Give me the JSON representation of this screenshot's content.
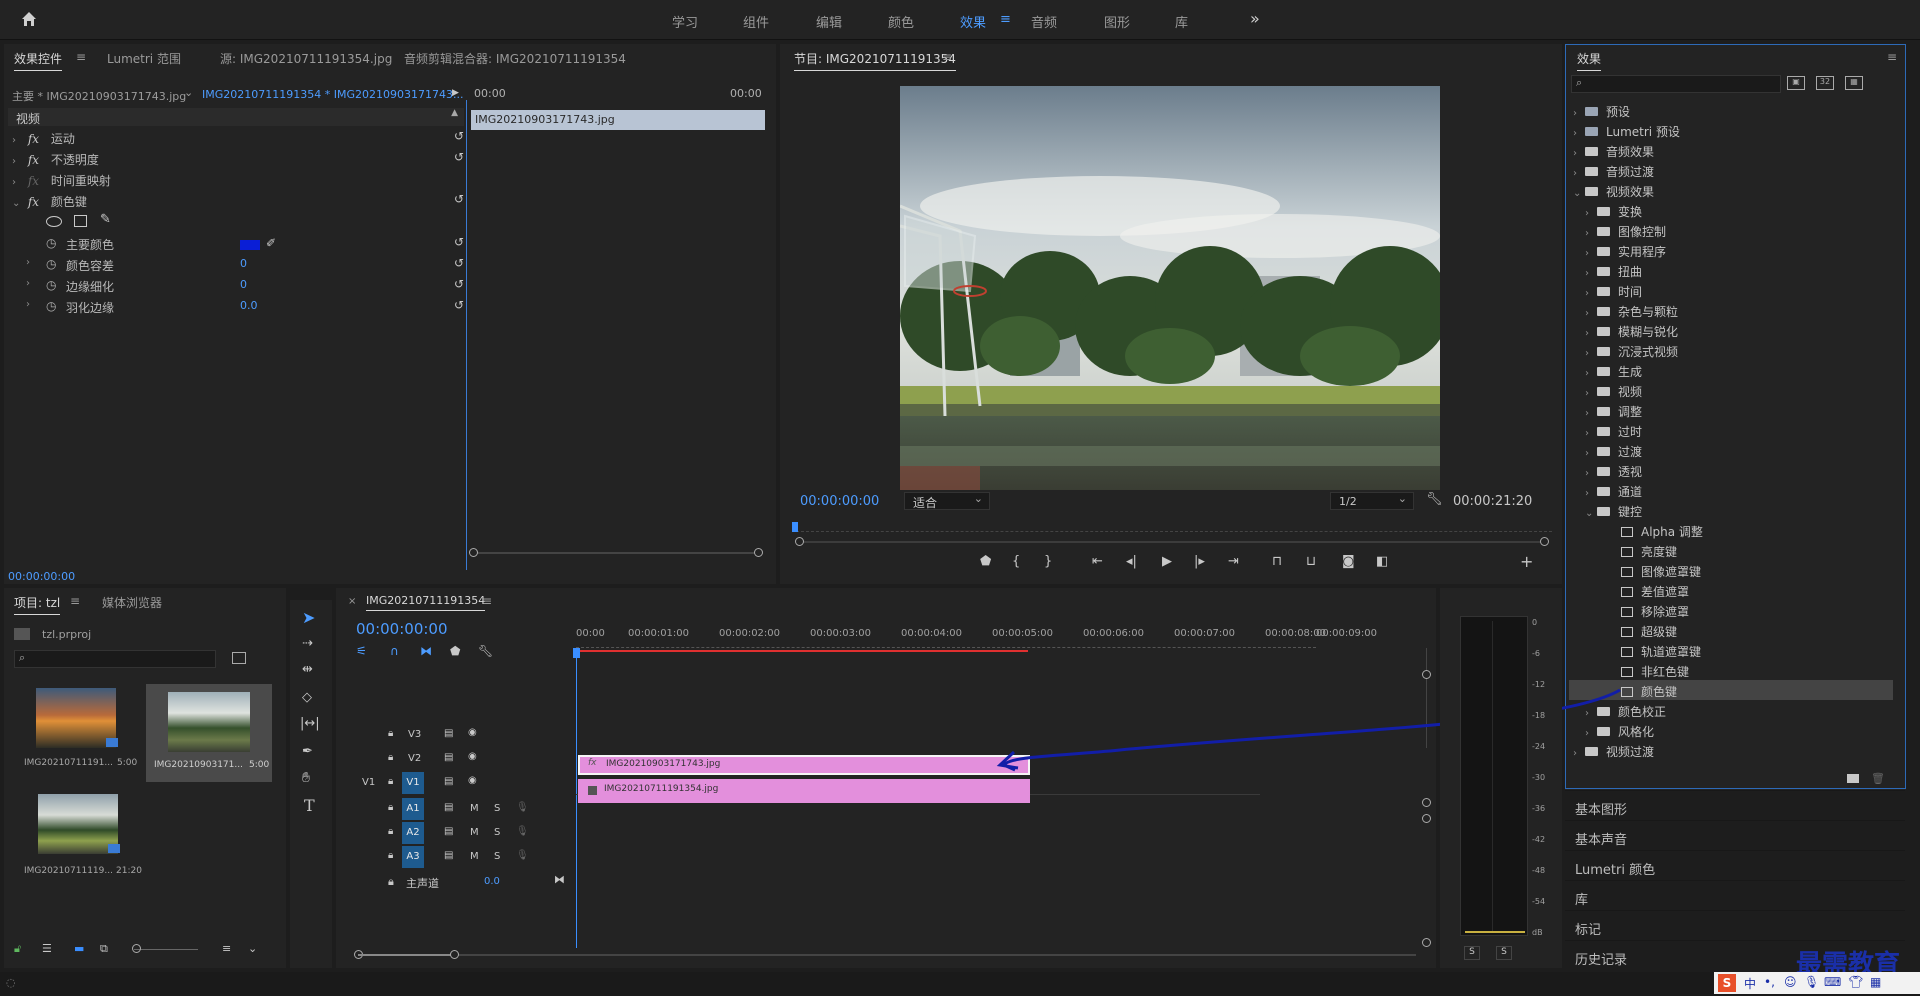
{
  "workspaces": {
    "items": [
      "学习",
      "组件",
      "编辑",
      "颜色",
      "效果",
      "音频",
      "图形",
      "库"
    ],
    "active_index": 4,
    "more": "»"
  },
  "effect_controls": {
    "tabs": [
      "效果控件",
      "Lumetri 范围",
      "源: IMG20210711191354.jpg",
      "音频剪辑混合器: IMG20210711191354"
    ],
    "master_label": "主要 * IMG20210903171743.jpg",
    "clip_label": "IMG20210711191354 * IMG20210903171743...",
    "time_start": "00:00",
    "time_end": "00:00",
    "clip_bar_name": "IMG20210903171743.jpg",
    "section_video": "视频",
    "effects": [
      {
        "fx": "fx",
        "name": "运动"
      },
      {
        "fx": "fx",
        "name": "不透明度"
      },
      {
        "fx": "fx",
        "name": "时间重映射"
      },
      {
        "fx": "fx",
        "name": "颜色键"
      }
    ],
    "params": [
      {
        "name": "主要颜色",
        "value": ""
      },
      {
        "name": "颜色容差",
        "value": "0"
      },
      {
        "name": "边缘细化",
        "value": "0"
      },
      {
        "name": "羽化边缘",
        "value": "0.0"
      }
    ],
    "key_color": "#0a1ed6",
    "timecode": "00:00:00:00"
  },
  "program": {
    "title": "节目: IMG20210711191354",
    "timecode": "00:00:00:00",
    "fit": "适合",
    "resolution": "1/2",
    "duration": "00:00:21:20"
  },
  "effects_panel": {
    "title": "效果",
    "search_placeholder": "",
    "tree": [
      {
        "label": "预设",
        "level": 0,
        "type": "special",
        "open": false
      },
      {
        "label": "Lumetri 预设",
        "level": 0,
        "type": "special",
        "open": false
      },
      {
        "label": "音频效果",
        "level": 0,
        "type": "folder",
        "open": false
      },
      {
        "label": "音频过渡",
        "level": 0,
        "type": "folder",
        "open": false
      },
      {
        "label": "视频效果",
        "level": 0,
        "type": "folder",
        "open": true
      },
      {
        "label": "变换",
        "level": 1,
        "type": "folder",
        "open": false
      },
      {
        "label": "图像控制",
        "level": 1,
        "type": "folder",
        "open": false
      },
      {
        "label": "实用程序",
        "level": 1,
        "type": "folder",
        "open": false
      },
      {
        "label": "扭曲",
        "level": 1,
        "type": "folder",
        "open": false
      },
      {
        "label": "时间",
        "level": 1,
        "type": "folder",
        "open": false
      },
      {
        "label": "杂色与颗粒",
        "level": 1,
        "type": "folder",
        "open": false
      },
      {
        "label": "模糊与锐化",
        "level": 1,
        "type": "folder",
        "open": false
      },
      {
        "label": "沉浸式视频",
        "level": 1,
        "type": "folder",
        "open": false
      },
      {
        "label": "生成",
        "level": 1,
        "type": "folder",
        "open": false
      },
      {
        "label": "视频",
        "level": 1,
        "type": "folder",
        "open": false
      },
      {
        "label": "调整",
        "level": 1,
        "type": "folder",
        "open": false
      },
      {
        "label": "过时",
        "level": 1,
        "type": "folder",
        "open": false
      },
      {
        "label": "过渡",
        "level": 1,
        "type": "folder",
        "open": false
      },
      {
        "label": "透视",
        "level": 1,
        "type": "folder",
        "open": false
      },
      {
        "label": "通道",
        "level": 1,
        "type": "folder",
        "open": false
      },
      {
        "label": "键控",
        "level": 1,
        "type": "folder",
        "open": true
      },
      {
        "label": "Alpha 调整",
        "level": 2,
        "type": "effect"
      },
      {
        "label": "亮度键",
        "level": 2,
        "type": "effect"
      },
      {
        "label": "图像遮罩键",
        "level": 2,
        "type": "effect"
      },
      {
        "label": "差值遮罩",
        "level": 2,
        "type": "effect"
      },
      {
        "label": "移除遮罩",
        "level": 2,
        "type": "effect"
      },
      {
        "label": "超级键",
        "level": 2,
        "type": "effect"
      },
      {
        "label": "轨道遮罩键",
        "level": 2,
        "type": "effect"
      },
      {
        "label": "非红色键",
        "level": 2,
        "type": "effect"
      },
      {
        "label": "颜色键",
        "level": 2,
        "type": "effect",
        "selected": true
      },
      {
        "label": "颜色校正",
        "level": 1,
        "type": "folder",
        "open": false
      },
      {
        "label": "风格化",
        "level": 1,
        "type": "folder",
        "open": false
      },
      {
        "label": "视频过渡",
        "level": 0,
        "type": "folder",
        "open": false
      }
    ],
    "sections": [
      "基本图形",
      "基本声音",
      "Lumetri 颜色",
      "库",
      "标记",
      "历史记录"
    ]
  },
  "project": {
    "tabs": [
      "项目: tzl",
      "媒体浏览器"
    ],
    "file": "tzl.prproj",
    "items": [
      {
        "name": "IMG20210711191...",
        "duration": "5:00"
      },
      {
        "name": "IMG20210903171...",
        "duration": "5:00"
      },
      {
        "name": "IMG20210711119...",
        "duration": "21:20"
      }
    ]
  },
  "timeline": {
    "title": "IMG20210711191354",
    "timecode": "00:00:00:00",
    "ruler": [
      "00:00",
      "00:00:01:00",
      "00:00:02:00",
      "00:00:03:00",
      "00:00:04:00",
      "00:00:05:00",
      "00:00:06:00",
      "00:00:07:00",
      "00:00:08:00",
      "00:00:09:00"
    ],
    "video_tracks": [
      "V3",
      "V2",
      "V1"
    ],
    "source_patch": "V1",
    "audio_tracks": [
      "A1",
      "A2",
      "A3"
    ],
    "mute": "M",
    "solo": "S",
    "master": "主声道",
    "master_value": "0.0",
    "clips": [
      {
        "track": "V2",
        "name": "IMG20210903171743.jpg",
        "fx": "fx"
      },
      {
        "track": "V1",
        "name": "IMG20210711191354.jpg",
        "fx": ""
      }
    ]
  },
  "meter": {
    "scale": [
      "0",
      "-6",
      "-12",
      "-18",
      "-24",
      "-30",
      "-36",
      "-42",
      "-48",
      "-54",
      "dB"
    ],
    "solo_left": "S",
    "solo_right": "S"
  },
  "watermark": "最需教育",
  "ime": "中"
}
